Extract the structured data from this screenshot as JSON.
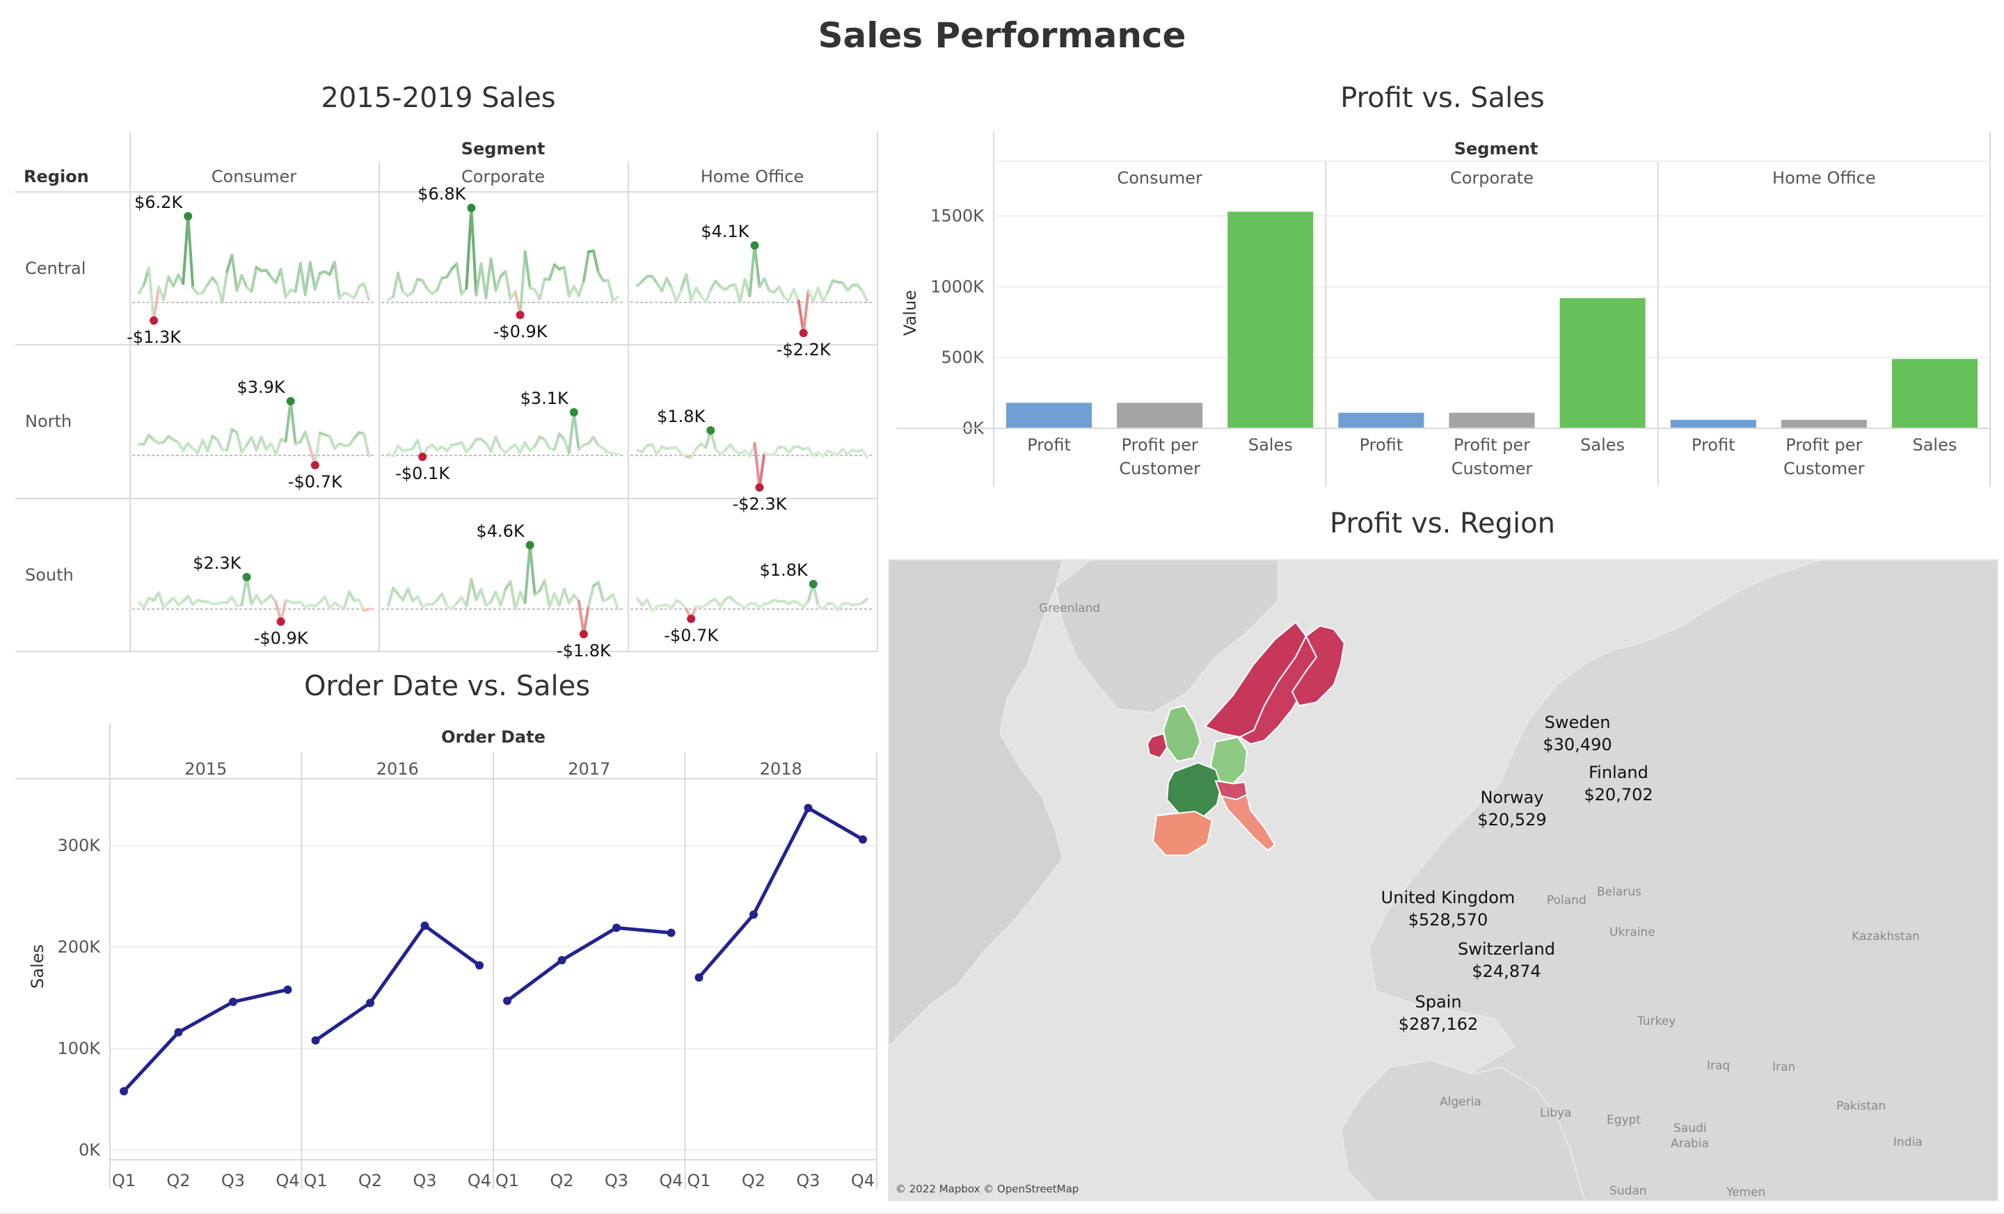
{
  "dashboard": {
    "title": "Sales Performance"
  },
  "colors": {
    "profit_bar": "#6f9fd2",
    "ppc_bar": "#a4a4a4",
    "sales_bar": "#66c15a",
    "line_series": "#23228f",
    "positive": "#2f8c3c",
    "negative": "#c21e3a",
    "grid": "#d9d9d9"
  },
  "sparkline_sheet": {
    "title": "2015-2019 Sales",
    "column_group_header": "Segment",
    "row_header": "Region",
    "segments": [
      "Consumer",
      "Corporate",
      "Home Office"
    ],
    "regions": [
      "Central",
      "North",
      "South"
    ]
  },
  "profit_sales_sheet": {
    "title": "Profit vs. Sales",
    "column_group_header": "Segment",
    "axis_label": "Value",
    "measure_labels": [
      [
        "Profit"
      ],
      [
        "Profit per",
        "Customer"
      ],
      [
        "Sales"
      ]
    ]
  },
  "order_date_sheet": {
    "title": "Order Date vs. Sales",
    "column_group_header": "Order Date",
    "axis_label": "Sales",
    "quarters": [
      "Q1",
      "Q2",
      "Q3",
      "Q4"
    ]
  },
  "map_sheet": {
    "title": "Profit vs. Region",
    "attribution": "© 2022 Mapbox © OpenStreetMap",
    "country_labels": [
      {
        "name": "Sweden",
        "value": "$30,490"
      },
      {
        "name": "Norway",
        "value": "$20,529"
      },
      {
        "name": "Finland",
        "value": "$20,702"
      },
      {
        "name": "United Kingdom",
        "value": "$528,570"
      },
      {
        "name": "Switzerland",
        "value": "$24,874"
      },
      {
        "name": "Spain",
        "value": "$287,162"
      }
    ],
    "basemap_labels": [
      "Greenland",
      "Poland",
      "Belarus",
      "Ukraine",
      "Kazakhstan",
      "Turkey",
      "Iraq",
      "Iran",
      "Pakistan",
      "India",
      "Algeria",
      "Libya",
      "Egypt",
      "Saudi",
      "Arabia",
      "Sudan",
      "Yemen"
    ]
  },
  "chart_data": [
    {
      "type": "line",
      "title": "2015-2019 Sales",
      "column_header": "Segment",
      "row_header": "Region",
      "columns": [
        "Consumer",
        "Corporate",
        "Home Office"
      ],
      "rows": [
        "Central",
        "North",
        "South"
      ],
      "cells": [
        {
          "region": "Central",
          "segment": "Consumer",
          "max": 6.2,
          "min": -1.3,
          "max_label": "$6.2K",
          "min_label": "-$1.3K"
        },
        {
          "region": "Central",
          "segment": "Corporate",
          "max": 6.8,
          "min": -0.9,
          "max_label": "$6.8K",
          "min_label": "-$0.9K"
        },
        {
          "region": "Central",
          "segment": "Home Office",
          "max": 4.1,
          "min": -2.2,
          "max_label": "$4.1K",
          "min_label": "-$2.2K"
        },
        {
          "region": "North",
          "segment": "Consumer",
          "max": 3.9,
          "min": -0.7,
          "max_label": "$3.9K",
          "min_label": "-$0.7K"
        },
        {
          "region": "North",
          "segment": "Corporate",
          "max": 3.1,
          "min": -0.1,
          "max_label": "$3.1K",
          "min_label": "-$0.1K"
        },
        {
          "region": "North",
          "segment": "Home Office",
          "max": 1.8,
          "min": -2.3,
          "max_label": "$1.8K",
          "min_label": "-$2.3K"
        },
        {
          "region": "South",
          "segment": "Consumer",
          "max": 2.3,
          "min": -0.9,
          "max_label": "$2.3K",
          "min_label": "-$0.9K"
        },
        {
          "region": "South",
          "segment": "Corporate",
          "max": 4.6,
          "min": -1.8,
          "max_label": "$4.6K",
          "min_label": "-$1.8K"
        },
        {
          "region": "South",
          "segment": "Home Office",
          "max": 1.8,
          "min": -0.7,
          "max_label": "$1.8K",
          "min_label": "-$0.7K"
        }
      ]
    },
    {
      "type": "bar",
      "title": "Profit vs. Sales",
      "column_header": "Segment",
      "ylabel": "Value",
      "ylim": [
        0,
        1650000
      ],
      "yticks": [
        0,
        500000,
        1000000,
        1500000
      ],
      "ytick_labels": [
        "0K",
        "500K",
        "1000K",
        "1500K"
      ],
      "groups": [
        "Consumer",
        "Corporate",
        "Home Office"
      ],
      "categories": [
        "Profit",
        "Profit per Customer",
        "Sales"
      ],
      "values": [
        [
          180000,
          180000,
          1530000
        ],
        [
          110000,
          110000,
          920000
        ],
        [
          60000,
          60000,
          490000
        ]
      ]
    },
    {
      "type": "line",
      "title": "Order Date vs. Sales",
      "column_header": "Order Date",
      "ylabel": "Sales",
      "ylim": [
        0,
        350000
      ],
      "yticks": [
        0,
        100000,
        200000,
        300000
      ],
      "ytick_labels": [
        "0K",
        "100K",
        "200K",
        "300K"
      ],
      "years": [
        "2015",
        "2016",
        "2017",
        "2018"
      ],
      "quarters": [
        "Q1",
        "Q2",
        "Q3",
        "Q4"
      ],
      "values": [
        [
          58000,
          116000,
          146000,
          158000
        ],
        [
          108000,
          145000,
          221000,
          182000
        ],
        [
          147000,
          187000,
          219000,
          214000
        ],
        [
          170000,
          232000,
          337000,
          306000
        ]
      ]
    },
    {
      "type": "map",
      "title": "Profit vs. Region",
      "countries": [
        {
          "name": "Sweden",
          "value": "$30,490"
        },
        {
          "name": "Norway",
          "value": "$20,529"
        },
        {
          "name": "Finland",
          "value": "$20,702"
        },
        {
          "name": "United Kingdom",
          "value": "$528,570"
        },
        {
          "name": "Switzerland",
          "value": "$24,874"
        },
        {
          "name": "Spain",
          "value": "$287,162"
        }
      ]
    }
  ]
}
